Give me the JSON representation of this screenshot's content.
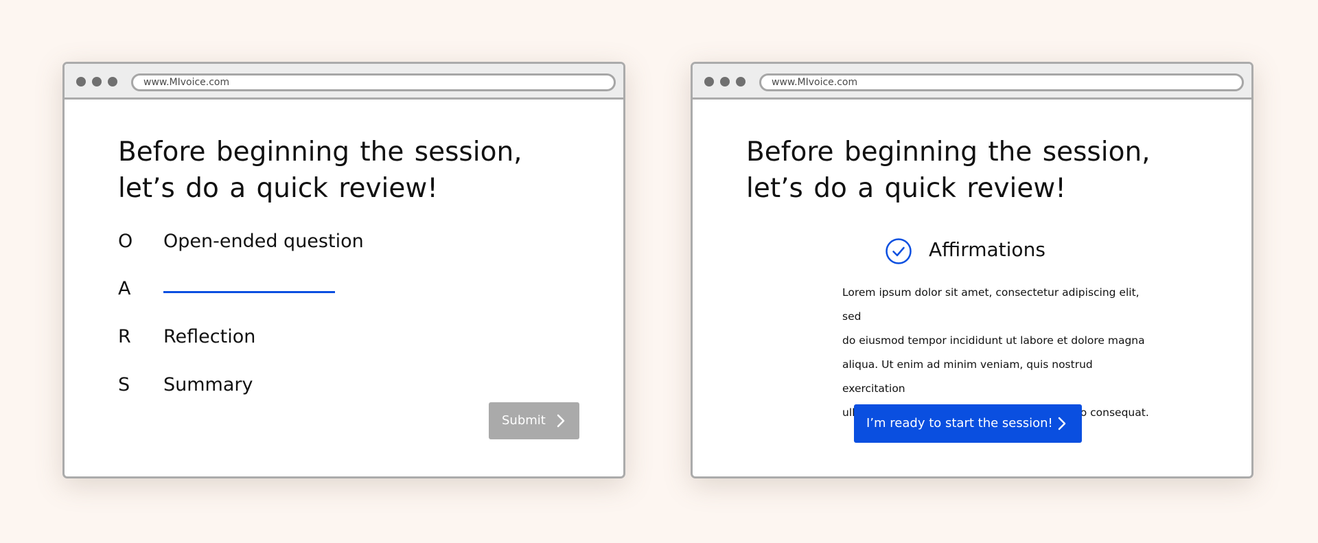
{
  "colors": {
    "background": "#fdf6f1",
    "accent": "#0a4fe0",
    "disabled_button": "#aaaaaa",
    "chrome": "#ededed",
    "border": "#ababab"
  },
  "left_window": {
    "url": "www.MIvoice.com",
    "heading_line1": "Before beginning the session,",
    "heading_line2": "let’s do a quick review!",
    "oars": [
      {
        "letter": "O",
        "text": "Open-ended question"
      },
      {
        "letter": "A",
        "text": "",
        "input_state": "empty"
      },
      {
        "letter": "R",
        "text": "Reflection"
      },
      {
        "letter": "S",
        "text": "Summary"
      }
    ],
    "submit_label": "Submit",
    "submit_icon": "chevron-right-icon"
  },
  "right_window": {
    "url": "www.MIvoice.com",
    "heading_line1": "Before beginning the session,",
    "heading_line2": "let’s do a quick review!",
    "section_icon": "check-circle-icon",
    "section_title": "Affirmations",
    "body_lines": [
      "Lorem ipsum dolor sit amet, consectetur adipiscing elit, sed",
      "do eiusmod tempor incididunt ut labore et dolore magna",
      "aliqua. Ut enim ad minim veniam, quis nostrud exercitation",
      "ullamco laboris nisi ut aliquip ex ea commodo consequat."
    ],
    "start_label": "I’m ready to start the session!",
    "start_icon": "chevron-right-icon"
  }
}
